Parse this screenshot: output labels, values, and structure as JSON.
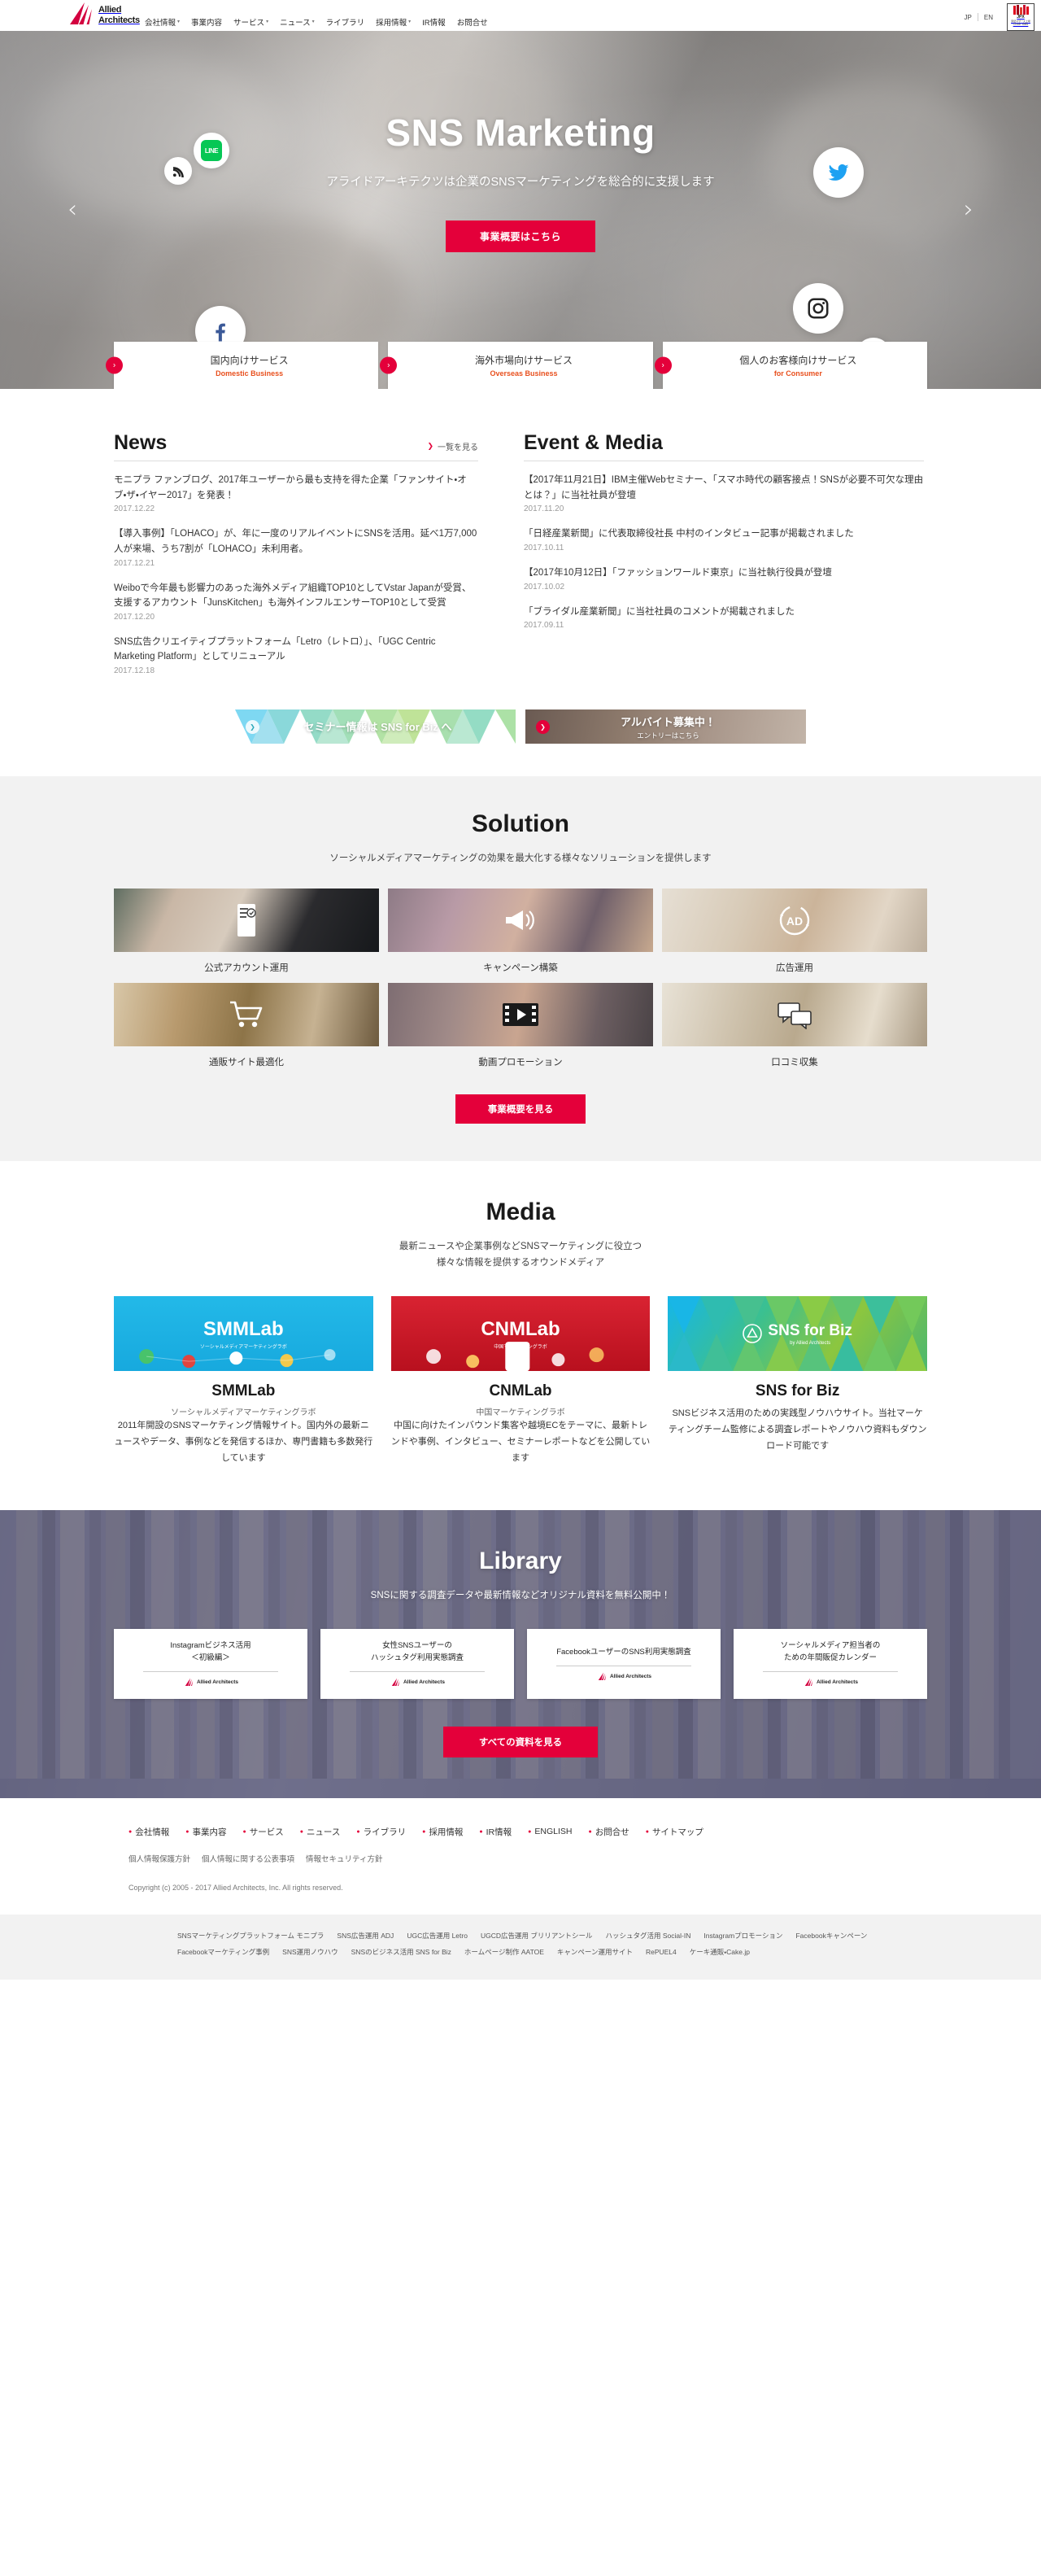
{
  "header": {
    "logo": {
      "line1": "Allied",
      "line2": "Architects"
    },
    "nav": [
      {
        "label": "会社情報",
        "has_dropdown": true
      },
      {
        "label": "事業内容",
        "has_dropdown": false
      },
      {
        "label": "サービス",
        "has_dropdown": true
      },
      {
        "label": "ニュース",
        "has_dropdown": true
      },
      {
        "label": "ライブラリ",
        "has_dropdown": false
      },
      {
        "label": "採用情報",
        "has_dropdown": true
      },
      {
        "label": "IR情報",
        "has_dropdown": false
      },
      {
        "label": "お問合せ",
        "has_dropdown": false
      }
    ],
    "lang": {
      "jp": "JP",
      "en": "EN"
    },
    "jpx": {
      "label": "JPX",
      "sub": "東証マザーズ上場",
      "code": "CODE: 6081"
    }
  },
  "hero": {
    "title": "SNS Marketing",
    "subtitle": "アライドアーキテクツは企業のSNSマーケティングを総合的に支援します",
    "cta": "事業概要はこちら",
    "prev_arrow": "‹",
    "next_arrow": "›",
    "social": [
      "rss-icon",
      "line-icon",
      "facebook-icon",
      "twitter-icon",
      "instagram-icon",
      "googleplus-icon"
    ],
    "services": [
      {
        "jp": "国内向けサービス",
        "en": "Domestic Business"
      },
      {
        "jp": "海外市場向けサービス",
        "en": "Overseas Business"
      },
      {
        "jp": "個人のお客様向けサービス",
        "en": "for Consumer"
      }
    ]
  },
  "news": {
    "title": "News",
    "more": "一覧を見る",
    "items": [
      {
        "text": "モニプラ ファンブログ、2017年ユーザーから最も支持を得た企業「ファンサイト・オブ・ザ・イヤー2017」を発表！",
        "date": "2017.12.22"
      },
      {
        "text": "【導入事例】「LOHACO」が、年に一度のリアルイベントにSNSを活用。延べ1万7,000人が来場、うち7割が「LOHACO」未利用者。",
        "date": "2017.12.21"
      },
      {
        "text": "Weiboで今年最も影響力のあった海外メディア組織TOP10としてVstar Japanが受賞、支援するアカウント「JunsKitchen」も海外インフルエンサーTOP10として受賞",
        "date": "2017.12.20"
      },
      {
        "text": "SNS広告クリエイティブプラットフォーム「Letro（レトロ）」、「UGC Centric Marketing Platform」としてリニューアル",
        "date": "2017.12.18"
      }
    ]
  },
  "event": {
    "title": "Event & Media",
    "items": [
      {
        "text": "【2017年11月21日】IBM主催Webセミナー、「スマホ時代の顧客接点！SNSが必要不可欠な理由とは？」に当社社員が登壇",
        "date": "2017.11.20"
      },
      {
        "text": "「日経産業新聞」に代表取締役社長 中村のインタビュー記事が掲載されました",
        "date": "2017.10.11"
      },
      {
        "text": "【2017年10月12日】「ファッションワールド東京」に当社執行役員が登壇",
        "date": "2017.10.02"
      },
      {
        "text": "「ブライダル産業新聞」に当社社員のコメントが掲載されました",
        "date": "2017.09.11"
      }
    ]
  },
  "banners": [
    {
      "text": "セミナー情報は SNS for Biz へ",
      "sub": ""
    },
    {
      "text": "アルバイト募集中！",
      "sub": "エントリーはこちら"
    }
  ],
  "solution": {
    "title": "Solution",
    "subtitle": "ソーシャルメディアマーケティングの効果を最大化する様々なソリューションを提供します",
    "cards": [
      {
        "label": "公式アカウント運用",
        "icon": "mobile-checklist-icon"
      },
      {
        "label": "キャンペーン構築",
        "icon": "megaphone-icon"
      },
      {
        "label": "広告運用",
        "icon": "ad-circle-icon"
      },
      {
        "label": "通販サイト最適化",
        "icon": "shopping-cart-icon"
      },
      {
        "label": "動画プロモーション",
        "icon": "film-strip-icon"
      },
      {
        "label": "口コミ収集",
        "icon": "speech-bubbles-icon"
      }
    ],
    "cta": "事業概要を見る"
  },
  "media": {
    "title": "Media",
    "subtitle_line1": "最新ニュースや企業事例などSNSマーケティングに役立つ",
    "subtitle_line2": "様々な情報を提供するオウンドメディア",
    "cards": [
      {
        "logo": "SMMLab",
        "logo_sub": "ソーシャルメディアマーケティングラボ",
        "name": "SMMLab",
        "tag": "ソーシャルメディアマーケティングラボ",
        "desc": "2011年開設のSNSマーケティング情報サイト。国内外の最新ニュースやデータ、事例などを発信するほか、専門書籍も多数発行しています"
      },
      {
        "logo": "CNMLab",
        "logo_sub": "中国マーケティングラボ",
        "name": "CNMLab",
        "tag": "中国マーケティングラボ",
        "desc": "中国に向けたインバウンド集客や越境ECをテーマに、最新トレンドや事例、インタビュー、セミナーレポートなどを公開しています"
      },
      {
        "logo": "SNS for Biz",
        "logo_sub": "by Allied Architects",
        "name": "SNS for Biz",
        "tag": "",
        "desc": "SNSビジネス活用のための実践型ノウハウサイト。当社マーケティングチーム監修による調査レポートやノウハウ資料もダウンロード可能です"
      }
    ]
  },
  "library": {
    "title": "Library",
    "subtitle": "SNSに関する調査データや最新情報などオリジナル資料を無料公開中！",
    "cards": [
      {
        "line1": "Instagramビジネス活用",
        "line2": "＜初級編＞",
        "brand": "Allied Architects"
      },
      {
        "line1": "女性SNSユーザーの",
        "line2": "ハッシュタグ利用実態調査",
        "brand": "Allied Architects"
      },
      {
        "line1": "FacebookユーザーのSNS利用実態調査",
        "line2": "",
        "brand": "Allied Architects"
      },
      {
        "line1": "ソーシャルメディア担当者の",
        "line2": "ための年間販促カレンダー",
        "brand": "Allied Architects"
      }
    ],
    "cta": "すべての資料を見る"
  },
  "footer": {
    "nav": [
      "会社情報",
      "事業内容",
      "サービス",
      "ニュース",
      "ライブラリ",
      "採用情報",
      "IR情報",
      "ENGLISH",
      "お問合せ",
      "サイトマップ"
    ],
    "policies": [
      "個人情報保護方針",
      "個人情報に関する公表事項",
      "情報セキュリティ方針"
    ],
    "copyright": "Copyright (c) 2005 - 2017 Allied Architects, Inc. All rights reserved.",
    "tags": [
      "SNSマーケティングプラットフォーム モニプラ",
      "SNS広告運用 ADJ",
      "UGC広告運用 Letro",
      "UGCD広告運用 ブリリアントシール",
      "ハッシュタグ活用 Social-IN",
      "Instagramプロモーション",
      "Facebookキャンペーン",
      "Facebookマーケティング事例",
      "SNS運用ノウハウ",
      "SNSのビジネス活用 SNS for Biz",
      "ホームページ制作 AATOE",
      "キャンペーン運用サイト",
      "RePUEL4",
      "ケーキ通販・Cake.jp"
    ]
  }
}
